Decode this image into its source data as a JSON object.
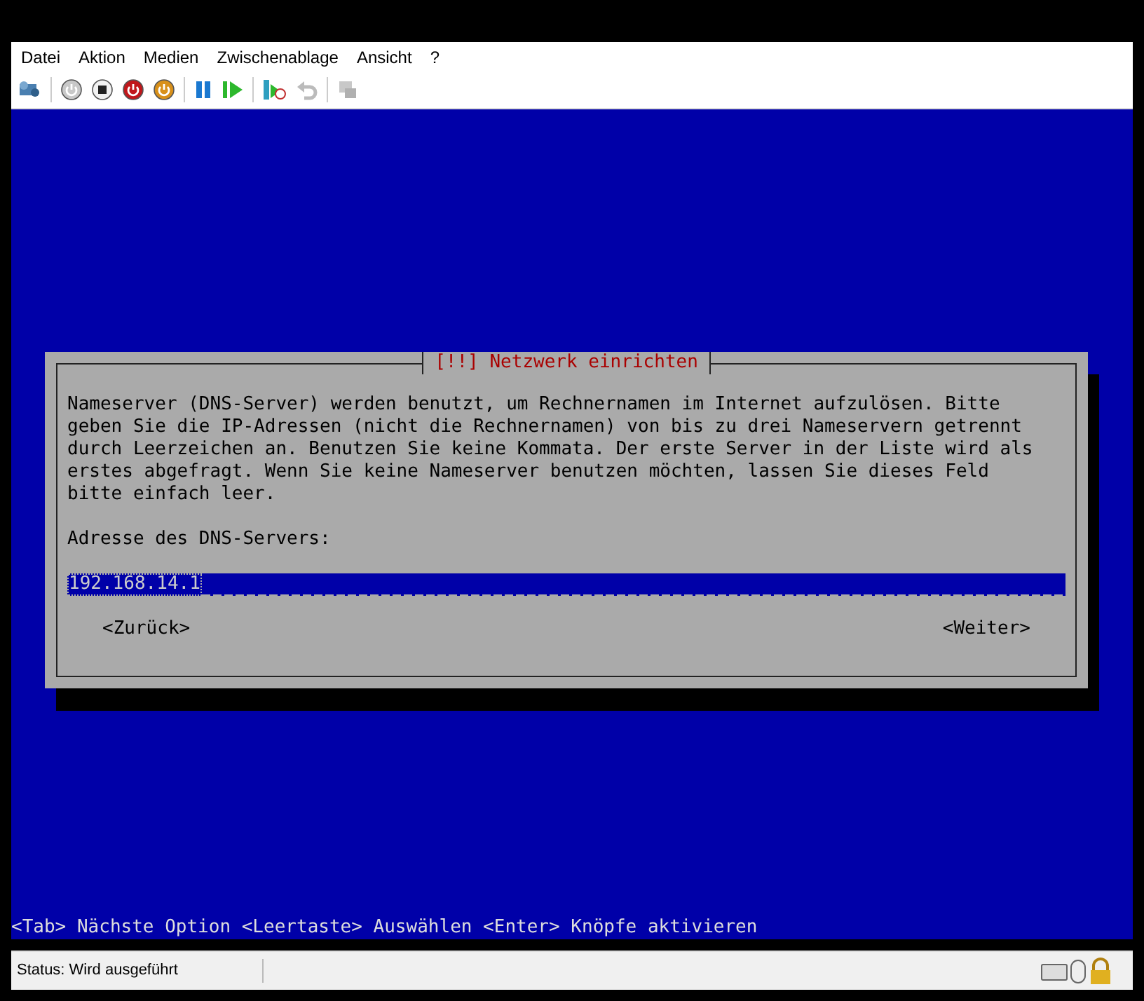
{
  "menu": [
    "Datei",
    "Aktion",
    "Medien",
    "Zwischenablage",
    "Ansicht",
    "?"
  ],
  "dialog": {
    "title": "[!!] Netzwerk einrichten",
    "message_lines": [
      "Nameserver (DNS-Server) werden benutzt, um Rechnernamen im Internet aufzulösen. Bitte",
      "geben Sie die IP-Adressen (nicht die Rechnernamen) von bis zu drei Nameservern getrennt",
      "durch Leerzeichen an. Benutzen Sie keine Kommata. Der erste Server in der Liste wird als",
      "erstes abgefragt. Wenn Sie keine Nameserver benutzen möchten, lassen Sie dieses Feld",
      "bitte einfach leer."
    ],
    "field_label": "Adresse des DNS-Servers:",
    "field_value": "192.168.14.1",
    "buttons": [
      {
        "label": "<Zurück>"
      },
      {
        "label": "<Weiter>"
      }
    ]
  },
  "hint_line": "<Tab> Nächste Option <Leertaste> Auswählen <Enter> Knöpfe aktivieren",
  "status_bar": {
    "text": "Status: Wird ausgeführt"
  }
}
